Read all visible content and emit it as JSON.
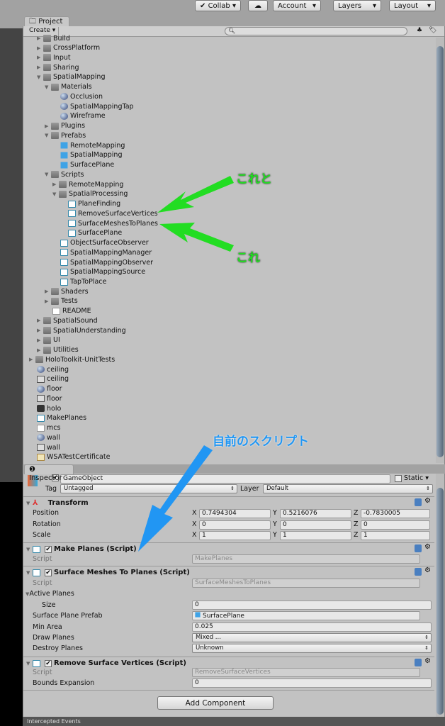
{
  "toolbar": {
    "collab": "Collab",
    "account": "Account",
    "layers": "Layers",
    "layout": "Layout"
  },
  "project": {
    "tab": "Project",
    "create": "Create",
    "search_placeholder": "",
    "tree": [
      {
        "d": 1,
        "t": "folder",
        "o": false,
        "n": "Build"
      },
      {
        "d": 1,
        "t": "folder",
        "o": false,
        "n": "CrossPlatform"
      },
      {
        "d": 1,
        "t": "folder",
        "o": false,
        "n": "Input"
      },
      {
        "d": 1,
        "t": "folder",
        "o": false,
        "n": "Sharing"
      },
      {
        "d": 1,
        "t": "folder",
        "o": true,
        "n": "SpatialMapping"
      },
      {
        "d": 2,
        "t": "folder",
        "o": true,
        "n": "Materials"
      },
      {
        "d": 3,
        "t": "material",
        "n": "Occlusion"
      },
      {
        "d": 3,
        "t": "material",
        "n": "SpatialMappingTap"
      },
      {
        "d": 3,
        "t": "material",
        "n": "Wireframe"
      },
      {
        "d": 2,
        "t": "folder",
        "o": false,
        "n": "Plugins"
      },
      {
        "d": 2,
        "t": "folder",
        "o": true,
        "n": "Prefabs"
      },
      {
        "d": 3,
        "t": "prefab",
        "n": "RemoteMapping"
      },
      {
        "d": 3,
        "t": "prefab",
        "n": "SpatialMapping"
      },
      {
        "d": 3,
        "t": "prefab",
        "n": "SurfacePlane"
      },
      {
        "d": 2,
        "t": "folder",
        "o": true,
        "n": "Scripts"
      },
      {
        "d": 3,
        "t": "folder",
        "o": false,
        "n": "RemoteMapping"
      },
      {
        "d": 3,
        "t": "folder",
        "o": true,
        "n": "SpatialProcessing"
      },
      {
        "d": 4,
        "t": "script",
        "n": "PlaneFinding"
      },
      {
        "d": 4,
        "t": "script",
        "n": "RemoveSurfaceVertices"
      },
      {
        "d": 4,
        "t": "script",
        "n": "SurfaceMeshesToPlanes"
      },
      {
        "d": 4,
        "t": "script",
        "n": "SurfacePlane"
      },
      {
        "d": 3,
        "t": "script",
        "n": "ObjectSurfaceObserver"
      },
      {
        "d": 3,
        "t": "script",
        "n": "SpatialMappingManager"
      },
      {
        "d": 3,
        "t": "script",
        "n": "SpatialMappingObserver"
      },
      {
        "d": 3,
        "t": "script",
        "n": "SpatialMappingSource"
      },
      {
        "d": 3,
        "t": "script",
        "n": "TapToPlace"
      },
      {
        "d": 2,
        "t": "folder",
        "o": false,
        "n": "Shaders"
      },
      {
        "d": 2,
        "t": "folder",
        "o": false,
        "n": "Tests"
      },
      {
        "d": 2,
        "t": "text",
        "n": "README"
      },
      {
        "d": 1,
        "t": "folder",
        "o": false,
        "n": "SpatialSound"
      },
      {
        "d": 1,
        "t": "folder",
        "o": false,
        "n": "SpatialUnderstanding"
      },
      {
        "d": 1,
        "t": "folder",
        "o": false,
        "n": "UI"
      },
      {
        "d": 1,
        "t": "folder",
        "o": false,
        "n": "Utilities"
      },
      {
        "d": 0,
        "t": "folder",
        "o": false,
        "n": "HoloToolkit-UnitTests"
      },
      {
        "d": 0,
        "t": "material",
        "n": "ceiling"
      },
      {
        "d": 0,
        "t": "texture",
        "n": "ceiling"
      },
      {
        "d": 0,
        "t": "material",
        "n": "floor"
      },
      {
        "d": 0,
        "t": "texture",
        "n": "floor"
      },
      {
        "d": 0,
        "t": "scene",
        "n": "holo"
      },
      {
        "d": 0,
        "t": "script",
        "n": "MakePlanes"
      },
      {
        "d": 0,
        "t": "text",
        "n": "mcs"
      },
      {
        "d": 0,
        "t": "material",
        "n": "wall"
      },
      {
        "d": 0,
        "t": "texture",
        "n": "wall"
      },
      {
        "d": 0,
        "t": "cert",
        "n": "WSATestCertificate"
      }
    ]
  },
  "inspector": {
    "tab": "Inspector",
    "object_name": "GameObject",
    "static": "Static",
    "tag_label": "Tag",
    "tag": "Untagged",
    "layer_label": "Layer",
    "layer": "Default",
    "transform": {
      "title": "Transform",
      "position": "Position",
      "rotation": "Rotation",
      "scale": "Scale",
      "x": "X",
      "y": "Y",
      "z": "Z",
      "pos": [
        "0.7494304",
        "0.5216076",
        "-0.7830005"
      ],
      "rot": [
        "0",
        "0",
        "0"
      ],
      "scl": [
        "1",
        "1",
        "1"
      ]
    },
    "make_planes": {
      "title": "Make Planes (Script)",
      "script_label": "Script",
      "script": "MakePlanes"
    },
    "smtp": {
      "title": "Surface Meshes To Planes (Script)",
      "script_label": "Script",
      "script": "SurfaceMeshesToPlanes",
      "active_planes": "Active Planes",
      "size_label": "Size",
      "size": "0",
      "prefab_label": "Surface Plane Prefab",
      "prefab": "SurfacePlane",
      "min_area_label": "Min Area",
      "min_area": "0.025",
      "draw_label": "Draw Planes",
      "draw": "Mixed ...",
      "destroy_label": "Destroy Planes",
      "destroy": "Unknown"
    },
    "rsv": {
      "title": "Remove Surface Vertices (Script)",
      "script_label": "Script",
      "script": "RemoveSurfaceVertices",
      "bounds_label": "Bounds Expansion",
      "bounds": "0"
    },
    "add_component": "Add Component",
    "intercepted": "Intercepted Events"
  },
  "annotations": {
    "green1": "これと",
    "green2": "これ",
    "blue": "自前のスクリプト",
    "green_color": "#22dd22",
    "blue_color": "#2196f3"
  }
}
